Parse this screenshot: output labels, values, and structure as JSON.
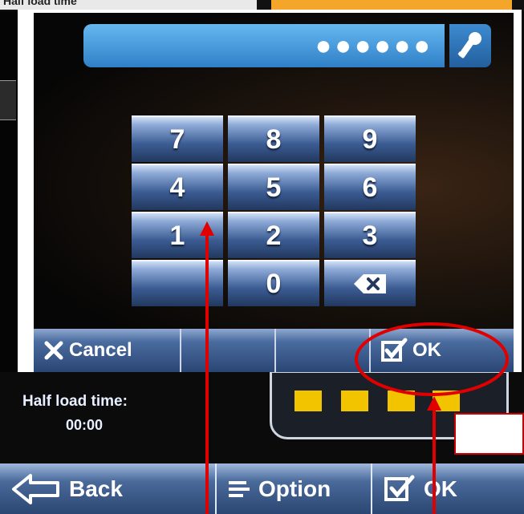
{
  "background": {
    "top_left_text": "Half load time",
    "half_load_label": "Half load time:",
    "half_load_value": "00:00",
    "load_segments": 4,
    "bottom_bar": {
      "back_label": "Back",
      "option_label": "Option",
      "ok_label": "OK"
    }
  },
  "dialog": {
    "pin_masked": "●●●●●●",
    "keypad": [
      "7",
      "8",
      "9",
      "4",
      "5",
      "6",
      "1",
      "2",
      "3",
      "0"
    ],
    "cancel_label": "Cancel",
    "ok_label": "OK"
  },
  "colors": {
    "annotation_red": "#e00000",
    "accent_orange": "#f3a629",
    "segment_yellow": "#f2c400"
  }
}
